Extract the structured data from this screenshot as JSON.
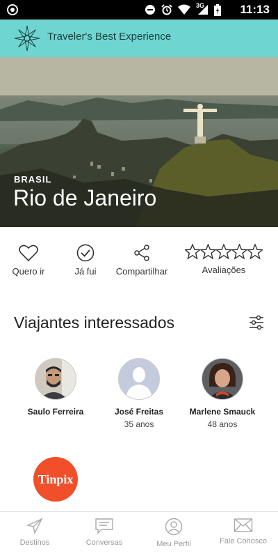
{
  "status_bar": {
    "time": "11:13",
    "network": "3G"
  },
  "app_bar": {
    "title": "Traveler's Best Experience"
  },
  "hero": {
    "country": "BRASIL",
    "city": "Rio de Janeiro"
  },
  "actions": [
    {
      "label": "Quero ir",
      "icon": "heart-icon"
    },
    {
      "label": "Já fui",
      "icon": "check-circle-icon"
    },
    {
      "label": "Compartilhar",
      "icon": "share-icon"
    },
    {
      "label": "Avaliações",
      "icon": "stars-icon",
      "stars": 0,
      "max_stars": 5
    }
  ],
  "section": {
    "title": "Viajantes interessados"
  },
  "travelers": [
    {
      "name": "Saulo Ferreira",
      "age": ""
    },
    {
      "name": "José Freitas",
      "age": "35 anos"
    },
    {
      "name": "Marlene Smauck",
      "age": "48 anos"
    },
    {
      "name": "",
      "age": "",
      "avatar_text": "Tinpix"
    }
  ],
  "bottom_nav": [
    {
      "label": "Destinos",
      "icon": "paper-plane-icon"
    },
    {
      "label": "Conversas",
      "icon": "chat-icon"
    },
    {
      "label": "Meu Perfil",
      "icon": "profile-icon"
    },
    {
      "label": "Fale Conosco",
      "icon": "mail-icon"
    }
  ],
  "colors": {
    "app_bar": "#6fd5d1",
    "tinpix": "#f04f2a"
  }
}
